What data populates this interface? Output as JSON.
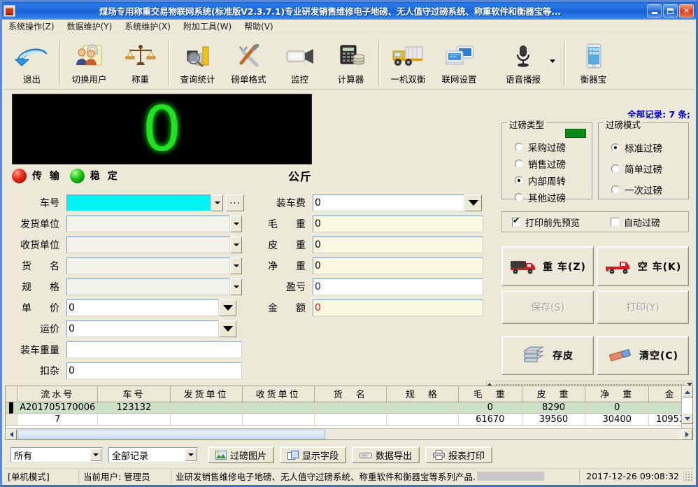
{
  "window": {
    "title": "煤场专用称重交易物联网系统(标准版V2.3.7.1)专业研发销售维修电子地磅、无人值守过磅系统、称重软件和衡器宝等...",
    "minimize": "minimize-button",
    "maximize": "maximize-button",
    "close_label": "✕"
  },
  "menubar": [
    {
      "label": "系统操作(Z)"
    },
    {
      "label": "数据维护(Y)"
    },
    {
      "label": "系统维护(X)"
    },
    {
      "label": "附加工具(W)"
    },
    {
      "label": "帮助(V)"
    }
  ],
  "toolbar": [
    {
      "label": "退出",
      "icon": "exit-arrow-icon"
    },
    {
      "label": "切换用户",
      "icon": "switch-user-icon"
    },
    {
      "label": "称重",
      "icon": "balance-scale-icon"
    },
    {
      "label": "查询统计",
      "icon": "statistics-icon"
    },
    {
      "label": "磅单格式",
      "icon": "tools-icon"
    },
    {
      "label": "监控",
      "icon": "camera-icon"
    },
    {
      "label": "计算器",
      "icon": "calculator-icon"
    },
    {
      "label": "一机双衡",
      "icon": "truck-icon"
    },
    {
      "label": "联网设置",
      "icon": "network-icon"
    },
    {
      "label": "语音播报",
      "icon": "microphone-icon"
    },
    {
      "label": "衡器宝",
      "icon": "phone-icon"
    }
  ],
  "display": {
    "weight": "0",
    "unit": "公斤",
    "transmit_label": "传 输",
    "stable_label": "稳 定",
    "transmit_state": "off",
    "stable_state": "on"
  },
  "form_left": [
    {
      "label": "车号",
      "value": "",
      "style": "cyan",
      "dropdown": true,
      "ellipsis": true
    },
    {
      "label": "发货单位",
      "value": "",
      "style": "gray",
      "dropdown": true
    },
    {
      "label": "收货单位",
      "value": "",
      "style": "gray",
      "dropdown": true
    },
    {
      "label": "货　名",
      "value": "",
      "style": "gray",
      "dropdown": true
    },
    {
      "label": "规　格",
      "value": "",
      "style": "gray",
      "dropdown": true
    },
    {
      "label": "单　价",
      "value": "0",
      "style": "white",
      "bigdropdown": true
    },
    {
      "label": "运价",
      "value": "0",
      "style": "white",
      "bigdropdown": true
    },
    {
      "label": "装车重量",
      "value": "",
      "style": "white"
    },
    {
      "label": "扣杂",
      "value": "0",
      "style": "white"
    }
  ],
  "form_mid": [
    {
      "label": "装车费",
      "value": "0",
      "style": "white",
      "bigdropdown": true
    },
    {
      "label": "毛　重",
      "value": "0",
      "style": "cream"
    },
    {
      "label": "皮　重",
      "value": "0",
      "style": "cream"
    },
    {
      "label": "净　重",
      "value": "0",
      "style": "cream"
    },
    {
      "label": "盈亏",
      "value": "0",
      "style": "white blue-text"
    },
    {
      "label": "金　额",
      "value": "0",
      "style": "cream red-text"
    }
  ],
  "records_count_text": "全部记录: 7 条;",
  "weigh_type": {
    "caption": "过磅类型",
    "options": [
      {
        "label": "采购过磅",
        "selected": false
      },
      {
        "label": "销售过磅",
        "selected": false
      },
      {
        "label": "内部周转",
        "selected": true
      },
      {
        "label": "其他过磅",
        "selected": false
      }
    ]
  },
  "weigh_mode": {
    "caption": "过磅模式",
    "options": [
      {
        "label": "标准过磅",
        "selected": true
      },
      {
        "label": "简单过磅",
        "selected": false
      },
      {
        "label": "一次过磅",
        "selected": false
      }
    ]
  },
  "checkboxes": [
    {
      "label": "打印前先预览",
      "checked": true
    },
    {
      "label": "自动过磅",
      "checked": false
    }
  ],
  "action_buttons": [
    {
      "label": "重 车(Z)",
      "icon": "loaded-truck-icon",
      "disabled": false
    },
    {
      "label": "空 车(K)",
      "icon": "empty-truck-icon",
      "disabled": false
    },
    {
      "label": "保存(S)",
      "icon": "",
      "disabled": true
    },
    {
      "label": "打印(Y)",
      "icon": "",
      "disabled": true
    },
    {
      "label": "存皮",
      "icon": "database-icon",
      "disabled": false
    },
    {
      "label": "清空(C)",
      "icon": "eraser-icon",
      "disabled": false
    }
  ],
  "grid": {
    "columns": [
      "流水号",
      "车号",
      "发货单位",
      "收货单位",
      "货　名",
      "规　格",
      "毛　重",
      "皮　重",
      "净　重",
      "金"
    ],
    "rows": [
      {
        "selected": true,
        "cells": [
          "A201705170006",
          "123132",
          "",
          "",
          "",
          "",
          "0",
          "8290",
          "0",
          ""
        ]
      },
      {
        "selected": false,
        "cells": [
          "7",
          "",
          "",
          "",
          "",
          "",
          "61670",
          "39560",
          "30400",
          "10953"
        ]
      }
    ]
  },
  "bottom": {
    "filter_scope": "所有",
    "filter_records": "全部记录",
    "buttons": [
      {
        "label": "过磅图片",
        "icon": "image-icon"
      },
      {
        "label": "显示字段",
        "icon": "columns-icon"
      },
      {
        "label": "数据导出",
        "icon": "export-icon"
      },
      {
        "label": "报表打印",
        "icon": "printer-icon"
      }
    ]
  },
  "status": {
    "mode": "[单机模式]",
    "user": "当前用户: 管理员",
    "marquee": "业研发销售维修电子地磅、无人值守过磅系统、称重软件和衡器宝等系列产品.",
    "datetime": "2017-12-26 09:08:32"
  },
  "colors": {
    "accent_blue": "#0000cc",
    "led_green": "#22e022",
    "face": "#ece9d8",
    "cyan_field": "#00f2f2",
    "cream_field": "#fbf8e0",
    "selected_row": "#cfe0c8"
  }
}
